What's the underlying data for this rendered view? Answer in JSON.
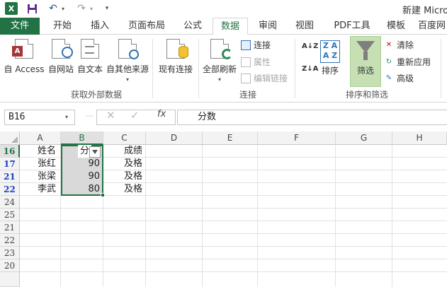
{
  "quick_access": {
    "app_logo": "X",
    "undo": "↶",
    "redo": "↷"
  },
  "window": {
    "title": "新建 Micro"
  },
  "tabs": [
    "文件",
    "开始",
    "插入",
    "页面布局",
    "公式",
    "数据",
    "审阅",
    "视图",
    "PDF工具",
    "模板",
    "百度网"
  ],
  "ribbon": {
    "external_data": {
      "group_label": "获取外部数据",
      "buttons": [
        "自 Access",
        "自网站",
        "自文本",
        "自其他来源",
        "现有连接"
      ]
    },
    "connections": {
      "group_label": "连接",
      "refresh_all": "全部刷新",
      "connections": "连接",
      "properties": "属性",
      "edit_links": "编辑链接"
    },
    "sort_filter": {
      "group_label": "排序和筛选",
      "sort_az": "A↓Z",
      "sort_za": "Z↓A",
      "sort": "排序",
      "filter": "筛选",
      "clear": "清除",
      "reapply": "重新应用",
      "advanced": "高级"
    }
  },
  "formula_bar": {
    "name_box": "B16",
    "cancel": "✕",
    "enter": "✓",
    "fx": "fx",
    "formula": "分数"
  },
  "sheet": {
    "columns": [
      "A",
      "B",
      "C",
      "D",
      "E",
      "F",
      "G",
      "H"
    ],
    "rows": [
      "16",
      "17",
      "21",
      "22",
      "24",
      "25",
      "21",
      "22",
      "23",
      "20"
    ],
    "cells": {
      "a16": "姓名",
      "b16": "分",
      "c16": "成绩",
      "a17": "张红",
      "b17": "90",
      "c17": "及格",
      "a21": "张梁",
      "b21": "90",
      "c21": "及格",
      "a22": "李武",
      "b22": "80",
      "c22": "及格"
    }
  }
}
